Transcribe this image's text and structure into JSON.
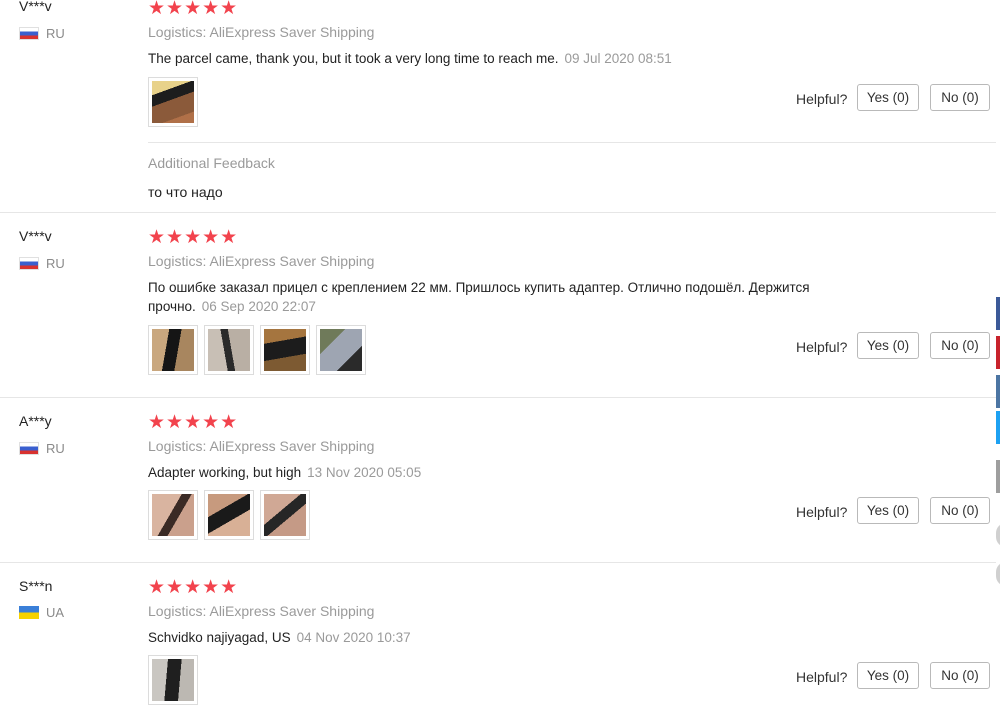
{
  "labels": {
    "helpful": "Helpful?",
    "logistics_prefix": "Logistics:",
    "additional_feedback": "Additional Feedback"
  },
  "reviews": [
    {
      "user": "V***v",
      "country": "RU",
      "stars": "★★★★★",
      "logistics": "AliExpress Saver Shipping",
      "text": "The parcel came, thank you, but it took a very long time to reach me.",
      "date": "09 Jul 2020 08:51",
      "yes": "Yes (0)",
      "no": "No (0)",
      "additional_feedback_text": "то что надо"
    },
    {
      "user": "V***v",
      "country": "RU",
      "stars": "★★★★★",
      "logistics": "AliExpress Saver Shipping",
      "text": "По ошибке заказал прицел с креплением 22 мм. Пришлось купить адаптер. Отлично подошёл. Держится прочно.",
      "date": "06 Sep 2020 22:07",
      "yes": "Yes (0)",
      "no": "No (0)"
    },
    {
      "user": "A***y",
      "country": "RU",
      "stars": "★★★★★",
      "logistics": "AliExpress Saver Shipping",
      "text": "Adapter working, but high",
      "date": "13 Nov 2020 05:05",
      "yes": "Yes (0)",
      "no": "No (0)"
    },
    {
      "user": "S***n",
      "country": "UA",
      "stars": "★★★★★",
      "logistics": "AliExpress Saver Shipping",
      "text": "Schvidko najiyagad, US",
      "date": "04 Nov 2020 10:37",
      "yes": "Yes (0)",
      "no": "No (0)"
    }
  ],
  "colors": {
    "star": "#f2434d",
    "muted_text": "#9a9a9a",
    "share_facebook": "#3b5998",
    "share_pinterest": "#c8232c",
    "share_vk": "#4c75a3",
    "share_twitter": "#1da1f2",
    "share_other": "#9e9e9e"
  }
}
